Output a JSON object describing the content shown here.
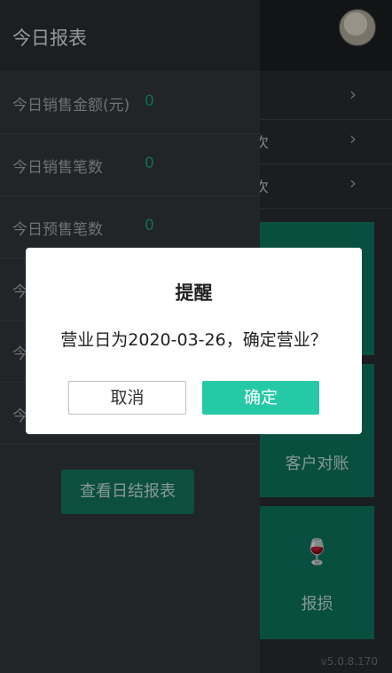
{
  "background": {
    "rows": [
      {
        "label": "",
        "chevron": "chevron-right-icon"
      },
      {
        "label": "次",
        "chevron": "chevron-right-icon"
      },
      {
        "label": "次",
        "chevron": "chevron-right-icon"
      }
    ],
    "tiles": [
      {
        "label": "客户对账"
      },
      {
        "label": "报损",
        "icon": "broken-glass-icon"
      }
    ],
    "version": "v5.0.8.170"
  },
  "drawer": {
    "title": "今日报表",
    "stats": [
      {
        "label": "今日销售金额(元)",
        "value": "0"
      },
      {
        "label": "今日销售笔数",
        "value": "0"
      },
      {
        "label": "今日预售笔数",
        "value": "0"
      },
      {
        "label": "今",
        "value": ""
      },
      {
        "label": "今",
        "value": ""
      },
      {
        "label": "今",
        "value": ""
      }
    ],
    "summary_button": "查看日结报表"
  },
  "dialog": {
    "title": "提醒",
    "message": "营业日为2020-03-26，确定营业？",
    "cancel_label": "取消",
    "confirm_label": "确定"
  },
  "colors": {
    "accent": "#26c9a6",
    "tile": "#0e7a62",
    "drawer_bg": "#33393d"
  }
}
